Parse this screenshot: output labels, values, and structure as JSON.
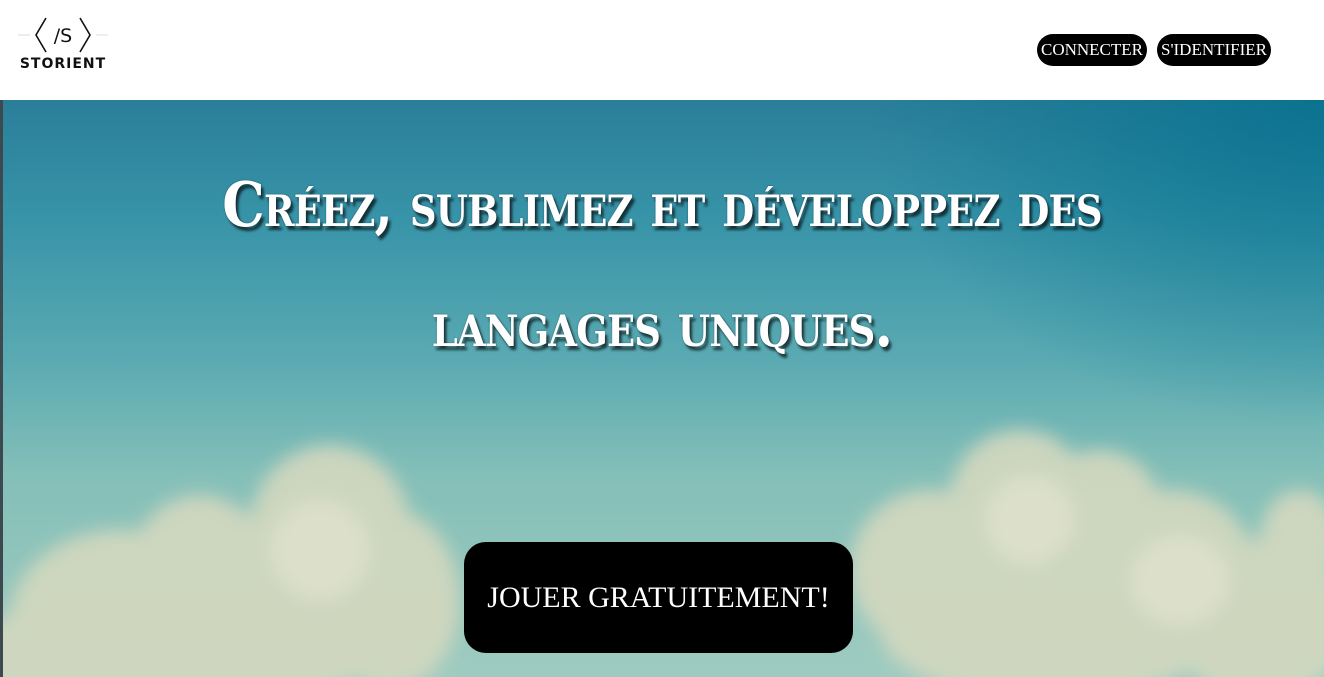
{
  "logo": {
    "mark_text": "/S",
    "name": "STORIENT"
  },
  "nav": {
    "connect_label": "CONNECTER",
    "signup_label": "S'IDENTIFIER"
  },
  "hero": {
    "headline_line1": "Créez, sublimez et développez des",
    "headline_line2": "langages uniques.",
    "cta_label": "JOUER GRATUITEMENT!"
  },
  "colors": {
    "button_bg": "#000000",
    "button_text": "#ffffff",
    "sky_top": "#2a7e99",
    "sky_bottom": "#9fcbc0"
  },
  "icons": {
    "logo_mark": "code-brackets-icon"
  }
}
